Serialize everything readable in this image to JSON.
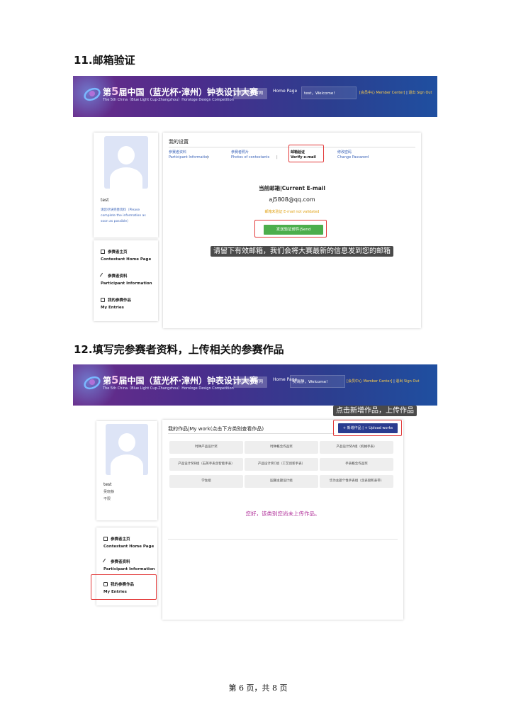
{
  "sections": [
    {
      "title": "11.邮箱验证"
    },
    {
      "title": "12.填写完参赛者资料，上传相关的参赛作品"
    }
  ],
  "banner": {
    "title_pre": "第",
    "title_num": "5",
    "title_post": "届中国（蓝光杯·漳州）钟表设计大赛",
    "subtitle": "The 5th China（Blue Light Cup·Zhangzhou）Horologe Design Competition",
    "back_btn": "返回大赛官网",
    "home_page": "Home Page",
    "member_center": "[会员中心 Member Center]",
    "sign_out": "退出 Sign Out",
    "separator": "|"
  },
  "shot1": {
    "welcome": "test，Welcome!",
    "username": "test",
    "profile_hint": "请您尽快完善资料（Please complete the information as soon as possible）",
    "menu": [
      {
        "cn": "参赛者主页",
        "en": "Contestant Home Page"
      },
      {
        "cn": "参赛者资料",
        "en": "Participant Information"
      },
      {
        "cn": "我的参赛作品",
        "en": "My Entries"
      }
    ],
    "settings_title": "我的设置",
    "tabs": [
      {
        "cn": "参赛者资料",
        "en": "Participant Information"
      },
      {
        "cn": "参赛者照片",
        "en": "Photos of contestants"
      },
      {
        "cn": "邮箱验证",
        "en": "Verify e-mail"
      },
      {
        "cn": "修改密码",
        "en": "Change Password"
      }
    ],
    "current_email_label": "当前邮箱|Current E-mail",
    "email": "aj5808@qq.com",
    "not_validated": "邮箱未验证 E-mail not validated",
    "send_btn": "发送验证邮件|Send",
    "tooltip": "请留下有效邮箱，我们会将大赛最新的信息发到您的邮箱"
  },
  "shot2": {
    "welcome": "吴晓静，Welcome!",
    "username": "test",
    "name_line": "吴晓静",
    "gender_line": "不限",
    "menu": [
      {
        "cn": "参赛者主页",
        "en": "Contestant Home Page"
      },
      {
        "cn": "参赛者资料",
        "en": "Participant Information"
      },
      {
        "cn": "我的参赛作品",
        "en": "My Entries"
      }
    ],
    "tooltip": "点击新增作品，上传作品",
    "works_title": "我的作品|My work(点击下方类别查看作品)",
    "upload_btn": "+ 新增作品 | + Upload works",
    "categories": [
      "时钟产品设计奖",
      "时钟概念作品奖",
      "产品设计奖A组（机械手表）",
      "产品设计奖B组（石英手表含智能手表）",
      "产品设计奖C组（工艺创新手表）",
      "手表概念作品奖",
      "学生组",
      "国潮主题设计组",
      "华为主题个性手表组（含表盘和表带）"
    ],
    "empty_msg": "您好，该类别您尚未上传作品。"
  },
  "footer": {
    "text": "第 6 页，共 8 页"
  },
  "colors": {
    "accent_red": "#e23a3a",
    "green": "#4cae4c",
    "navy": "#2a3b8f",
    "empty_msg": "#b0309a"
  }
}
